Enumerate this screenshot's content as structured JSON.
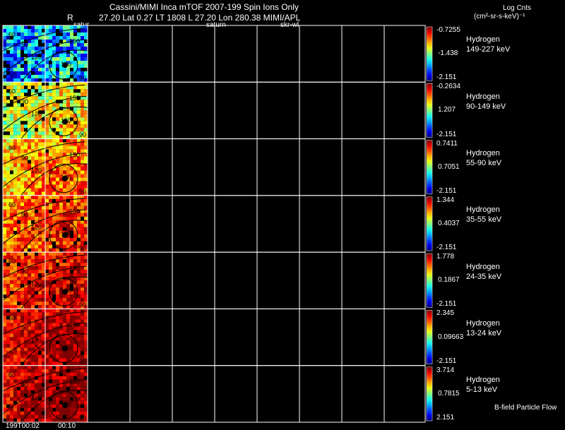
{
  "header": {
    "title": "Cassini/MIMI Inca mTOF  2007-199   Spin    Ions Only",
    "line2_r": "R",
    "line2_rest": "27.20 Lat 0.27 LT 1808 L          27.20 Lon          280.38  MIMI/APL",
    "label_satur": "satur",
    "label_saturn": "saturn",
    "label_skr": "skr-wl",
    "units_title": "Log Cnts",
    "units_sub": "(cm²-sr-s-keV)⁻¹"
  },
  "footer": {
    "start_time": "199T00:02",
    "next_time": "00:10",
    "bfield_label": "B-field Particle Flow"
  },
  "chart_data": {
    "type": "heatmap",
    "title": "Cassini/MIMI Inca mTOF  2007-199   Spin    Ions Only",
    "contour_labels": [
      "60",
      "90",
      "120",
      "150",
      "180",
      "90"
    ],
    "x_tick_labels": [
      "199T00:02",
      "00:10"
    ],
    "panels": [
      {
        "species": "Hydrogen",
        "energy": "149-227 keV",
        "cb_max": "-0.7255",
        "cb_mid": "-1.438",
        "cb_min": "-2.151",
        "level": 0.25
      },
      {
        "species": "Hydrogen",
        "energy": "90-149 keV",
        "cb_max": "-0.2634",
        "cb_mid": "1.207",
        "cb_min": "-2.151",
        "level": 0.55
      },
      {
        "species": "Hydrogen",
        "energy": "55-90 keV",
        "cb_max": "0.7411",
        "cb_mid": "0.7051",
        "cb_min": "-2.151",
        "level": 0.68
      },
      {
        "species": "Hydrogen",
        "energy": "35-55 keV",
        "cb_max": "1.344",
        "cb_mid": "0.4037",
        "cb_min": "-2.151",
        "level": 0.75
      },
      {
        "species": "Hydrogen",
        "energy": "24-35 keV",
        "cb_max": "1.778",
        "cb_mid": "0.1867",
        "cb_min": "-2.151",
        "level": 0.82
      },
      {
        "species": "Hydrogen",
        "energy": "13-24 keV",
        "cb_max": "2.345",
        "cb_mid": "0.09663",
        "cb_min": "-2.151",
        "level": 0.88
      },
      {
        "species": "Hydrogen",
        "energy": "5-13 keV",
        "cb_max": "3.714",
        "cb_mid": "0.7815",
        "cb_min": "2.151",
        "level": 0.9
      }
    ]
  }
}
